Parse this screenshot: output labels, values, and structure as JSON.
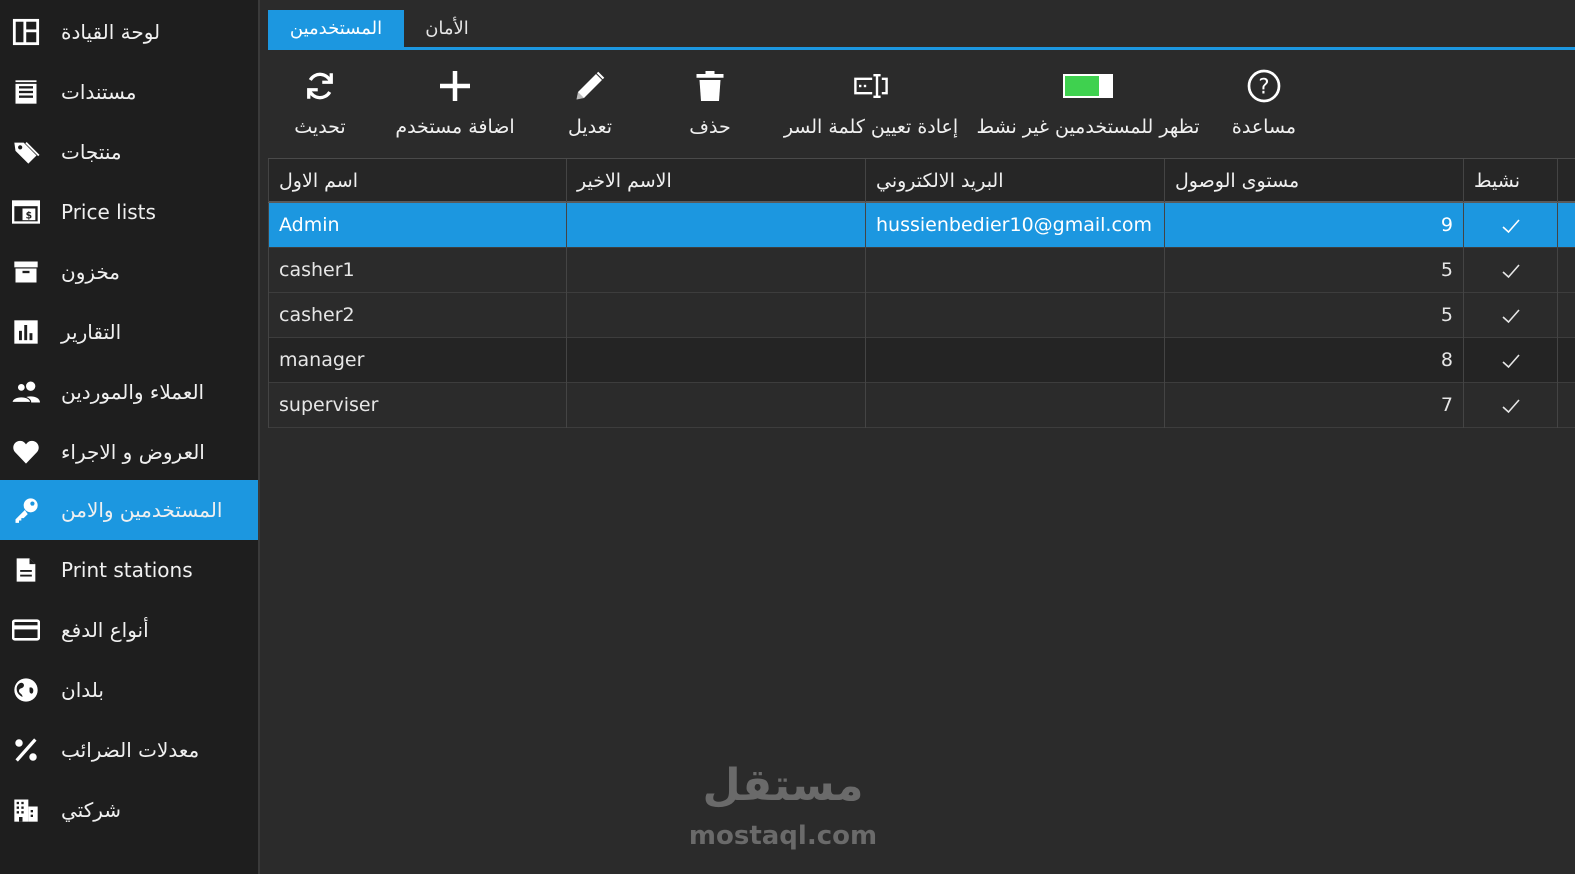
{
  "sidebar": {
    "items": [
      {
        "label": "لوحة القيادة",
        "icon": "dashboard-icon"
      },
      {
        "label": "مستندات",
        "icon": "documents-icon"
      },
      {
        "label": "منتجات",
        "icon": "tag-icon"
      },
      {
        "label": "Price lists",
        "icon": "price-list-icon"
      },
      {
        "label": "مخزون",
        "icon": "inventory-icon"
      },
      {
        "label": "التقارير",
        "icon": "reports-icon"
      },
      {
        "label": "العملاء والموردين",
        "icon": "people-icon"
      },
      {
        "label": "العروض و الاجراء",
        "icon": "heart-icon"
      },
      {
        "label": "المستخدمين والامن",
        "icon": "key-icon",
        "active": true
      },
      {
        "label": "Print stations",
        "icon": "print-station-icon"
      },
      {
        "label": "أنواع الدفع",
        "icon": "credit-card-icon"
      },
      {
        "label": "بلدان",
        "icon": "globe-icon"
      },
      {
        "label": "معدلات الضرائب",
        "icon": "percent-icon"
      },
      {
        "label": "شركتي",
        "icon": "company-icon"
      }
    ]
  },
  "tabs": {
    "users": "المستخدمين",
    "security": "الأمان"
  },
  "toolbar": {
    "refresh": "تحديث",
    "add_user": "اضافة مستخدم",
    "edit": "تعديل",
    "delete": "حذف",
    "reset_password": "إعادة تعيين كلمة السر",
    "show_inactive": "تظهر للمستخدمين غير نشط",
    "help": "مساعدة"
  },
  "colors": {
    "accent": "#1c97e0",
    "toggle_green": "#3fd14f"
  },
  "grid": {
    "headers": {
      "first_name": "اسم الاول",
      "last_name": "الاسم الاخير",
      "email": "البريد الالكتروني",
      "access_level": "مستوى الوصول",
      "active": "نشيط"
    },
    "rows": [
      {
        "first_name": "Admin",
        "last_name": "",
        "email": "hussienbedier10@gmail.com",
        "access_level": "9",
        "active": true,
        "selected": true
      },
      {
        "first_name": "casher1",
        "last_name": "",
        "email": "",
        "access_level": "5",
        "active": true
      },
      {
        "first_name": "casher2",
        "last_name": "",
        "email": "",
        "access_level": "5",
        "active": true
      },
      {
        "first_name": "manager",
        "last_name": "",
        "email": "",
        "access_level": "8",
        "active": true
      },
      {
        "first_name": "superviser",
        "last_name": "",
        "email": "",
        "access_level": "7",
        "active": true
      }
    ]
  },
  "watermark": {
    "logo_text": "مستقل",
    "url": "mostaql.com"
  }
}
